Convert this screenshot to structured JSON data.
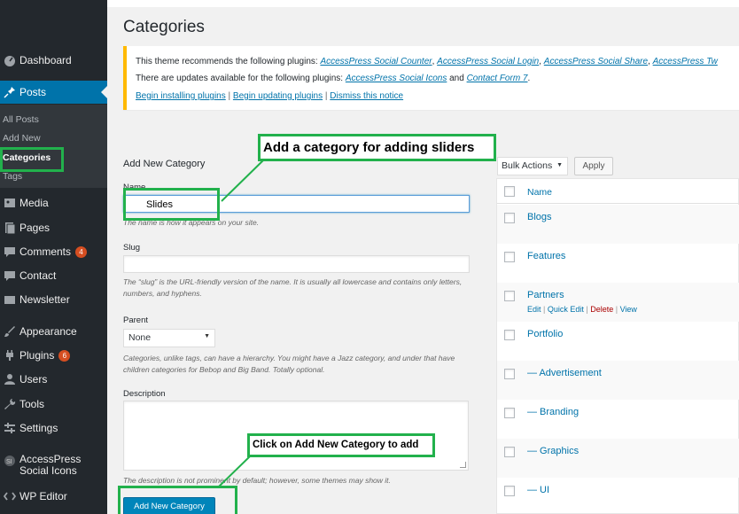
{
  "colors": {
    "sidebar_bg": "#23282d",
    "accent": "#0073aa",
    "notice_border": "#ffb900",
    "callout_green": "#22b14c"
  },
  "sidebar": {
    "items": [
      {
        "icon": "dashboard-icon",
        "label": "Dashboard"
      },
      {
        "icon": "pin-icon",
        "label": "Posts"
      },
      {
        "icon": "media-icon",
        "label": "Media"
      },
      {
        "icon": "pages-icon",
        "label": "Pages"
      },
      {
        "icon": "comment-icon",
        "label": "Comments",
        "badge": "4"
      },
      {
        "icon": "contact-icon",
        "label": "Contact"
      },
      {
        "icon": "mail-icon",
        "label": "Newsletter"
      },
      {
        "icon": "brush-icon",
        "label": "Appearance"
      },
      {
        "icon": "plugin-icon",
        "label": "Plugins",
        "badge": "6"
      },
      {
        "icon": "users-icon",
        "label": "Users"
      },
      {
        "icon": "wrench-icon",
        "label": "Tools"
      },
      {
        "icon": "settings-icon",
        "label": "Settings"
      },
      {
        "icon": "accesspress-icon",
        "label": "AccessPress",
        "label2": "Social Icons"
      },
      {
        "icon": "editor-icon",
        "label": "WP Editor"
      }
    ],
    "submenu": [
      "All Posts",
      "Add New",
      "Categories",
      "Tags"
    ]
  },
  "page_title": "Categories",
  "notice": {
    "line1_prefix": "This theme recommends the following plugins:",
    "line1_links": [
      "AccessPress Social Counter",
      "AccessPress Social Login",
      "AccessPress Social Share",
      "AccessPress Tw"
    ],
    "line2_prefix": "There are updates available for the following plugins:",
    "line2_link1": "AccessPress Social Icons",
    "line2_and": "and",
    "line2_link2": "Contact Form 7",
    "line3_links": [
      "Begin installing plugins",
      "Begin updating plugins",
      "Dismiss this notice"
    ]
  },
  "form": {
    "heading": "Add New Category",
    "name_label": "Name",
    "name_value": "Slides",
    "name_help": "The name is how it appears on your site.",
    "slug_label": "Slug",
    "slug_help": "The “slug” is the URL-friendly version of the name. It is usually all lowercase and contains only letters, numbers, and hyphens.",
    "parent_label": "Parent",
    "parent_value": "None",
    "parent_help": "Categories, unlike tags, can have a hierarchy. You might have a Jazz category, and under that have children categories for Bebop and Big Band. Totally optional.",
    "description_label": "Description",
    "description_help": "The description is not prominent by default; however, some themes may show it.",
    "submit_label": "Add New Category"
  },
  "callouts": {
    "add_category": "Add a category for adding sliders",
    "click_add": "Click on Add New Category to add"
  },
  "table": {
    "bulk_actions": "Bulk Actions",
    "apply": "Apply",
    "column_name": "Name",
    "rows": [
      "Blogs",
      "Features",
      "Partners",
      "Portfolio",
      "— Advertisement",
      "— Branding",
      "— Graphics",
      "— UI"
    ],
    "row_actions": {
      "edit": "Edit",
      "quick_edit": "Quick Edit",
      "delete": "Delete",
      "view": "View"
    }
  }
}
